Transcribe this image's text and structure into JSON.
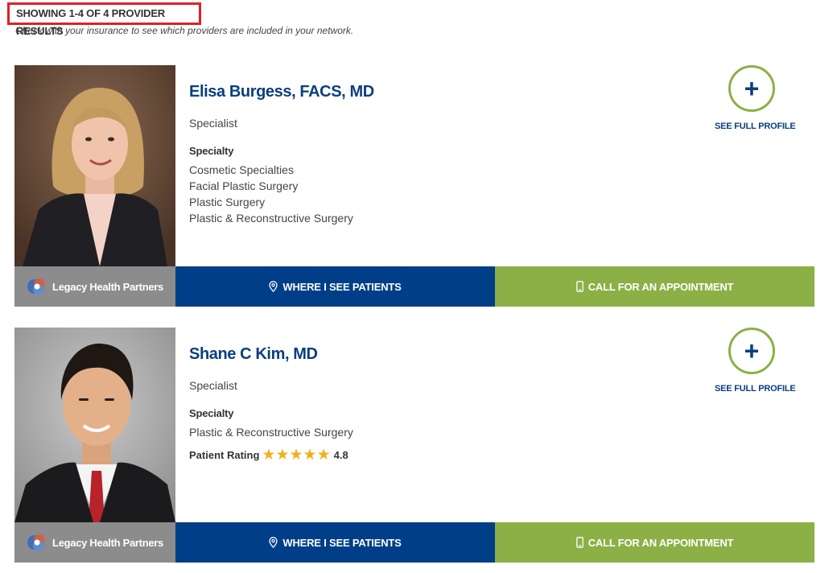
{
  "results": {
    "count_label": "SHOWING 1-4 OF 4 PROVIDER RESULTS",
    "insurance_note": "Check with your insurance to see which providers are included in your network."
  },
  "colors": {
    "brand_blue": "#003f87",
    "brand_green": "#8cb045",
    "network_gray": "#8c8c8c",
    "highlight_red": "#e21f26",
    "star_gold": "#f2b01e"
  },
  "providers": [
    {
      "name": "Elisa Burgess, FACS, MD",
      "role": "Specialist",
      "specialty_heading": "Specialty",
      "specialties": [
        "Cosmetic Specialties",
        "Facial Plastic Surgery",
        "Plastic Surgery",
        "Plastic & Reconstructive Surgery"
      ],
      "profile_label": "SEE FULL PROFILE",
      "profile_icon": "plus-icon",
      "network_label": "Legacy Health Partners",
      "locations_label": "WHERE I SEE PATIENTS",
      "call_label": "CALL FOR AN APPOINTMENT"
    },
    {
      "name": "Shane C Kim, MD",
      "role": "Specialist",
      "specialty_heading": "Specialty",
      "specialties": [
        "Plastic & Reconstructive Surgery"
      ],
      "rating_label": "Patient Rating",
      "rating_value": "4.8",
      "rating_stars": 5,
      "profile_label": "SEE FULL PROFILE",
      "profile_icon": "plus-icon",
      "network_label": "Legacy Health Partners",
      "locations_label": "WHERE I SEE PATIENTS",
      "call_label": "CALL FOR AN APPOINTMENT"
    }
  ]
}
